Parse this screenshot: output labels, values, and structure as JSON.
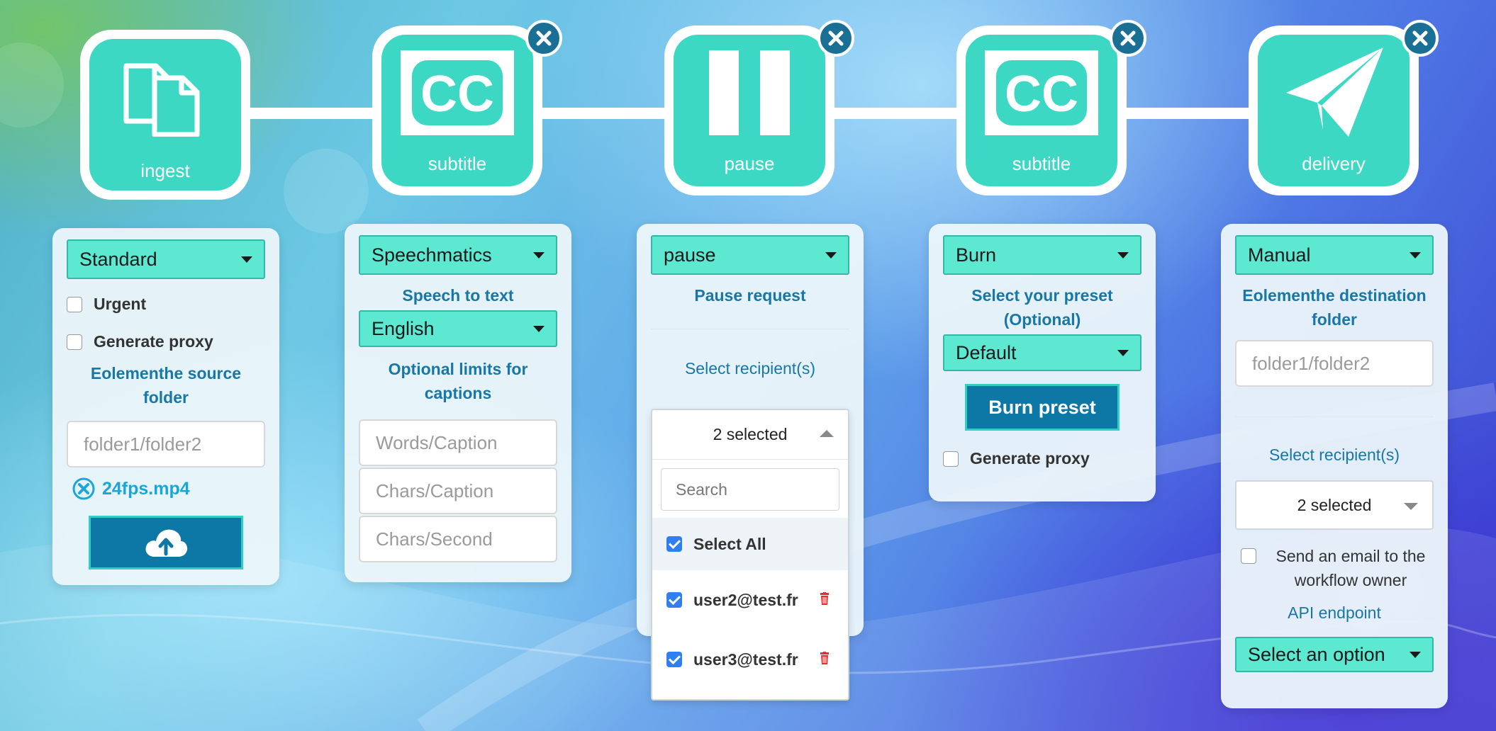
{
  "colors": {
    "accent": "#3dd8c4",
    "select_bg": "#5de8d2",
    "heading": "#1877a6",
    "button": "#0d78a6",
    "close": "#1a6f95"
  },
  "nodes": [
    {
      "label": "ingest",
      "icon": "documents-icon",
      "closable": false
    },
    {
      "label": "subtitle",
      "icon": "cc-icon",
      "closable": true
    },
    {
      "label": "pause",
      "icon": "pause-icon",
      "closable": true
    },
    {
      "label": "subtitle",
      "icon": "cc-icon",
      "closable": true
    },
    {
      "label": "delivery",
      "icon": "paper-plane-icon",
      "closable": true
    }
  ],
  "ingest": {
    "priority_select": "Standard",
    "urgent_label": "Urgent",
    "proxy_label": "Generate proxy",
    "source_folder_heading": "Eolementhe source folder",
    "folder_placeholder": "folder1/folder2",
    "file_name": "24fps.mp4",
    "upload_icon": "cloud-upload-icon"
  },
  "subtitle1": {
    "engine_select": "Speechmatics",
    "speech_heading": "Speech to text",
    "language_select": "English",
    "limits_heading": "Optional limits for captions",
    "words_placeholder": "Words/Caption",
    "chars_placeholder": "Chars/Caption",
    "chars_sec_placeholder": "Chars/Second"
  },
  "pause": {
    "type_select": "pause",
    "request_heading": "Pause request",
    "recipients_label": "Select recipient(s)",
    "selected_text": "2 selected",
    "search_placeholder": "Search",
    "select_all_label": "Select All",
    "recipients": [
      "user2@test.fr",
      "user3@test.fr"
    ]
  },
  "subtitle2": {
    "mode_select": "Burn",
    "preset_heading": "Select your preset (Optional)",
    "preset_select": "Default",
    "burn_button": "Burn preset",
    "proxy_label": "Generate proxy"
  },
  "delivery": {
    "mode_select": "Manual",
    "destination_heading": "Eolementhe destination folder",
    "folder_placeholder": "folder1/folder2",
    "recipients_label": "Select recipient(s)",
    "selected_text": "2 selected",
    "email_label": "Send an email to the workflow owner",
    "api_label": "API endpoint",
    "api_select": "Select an option"
  }
}
